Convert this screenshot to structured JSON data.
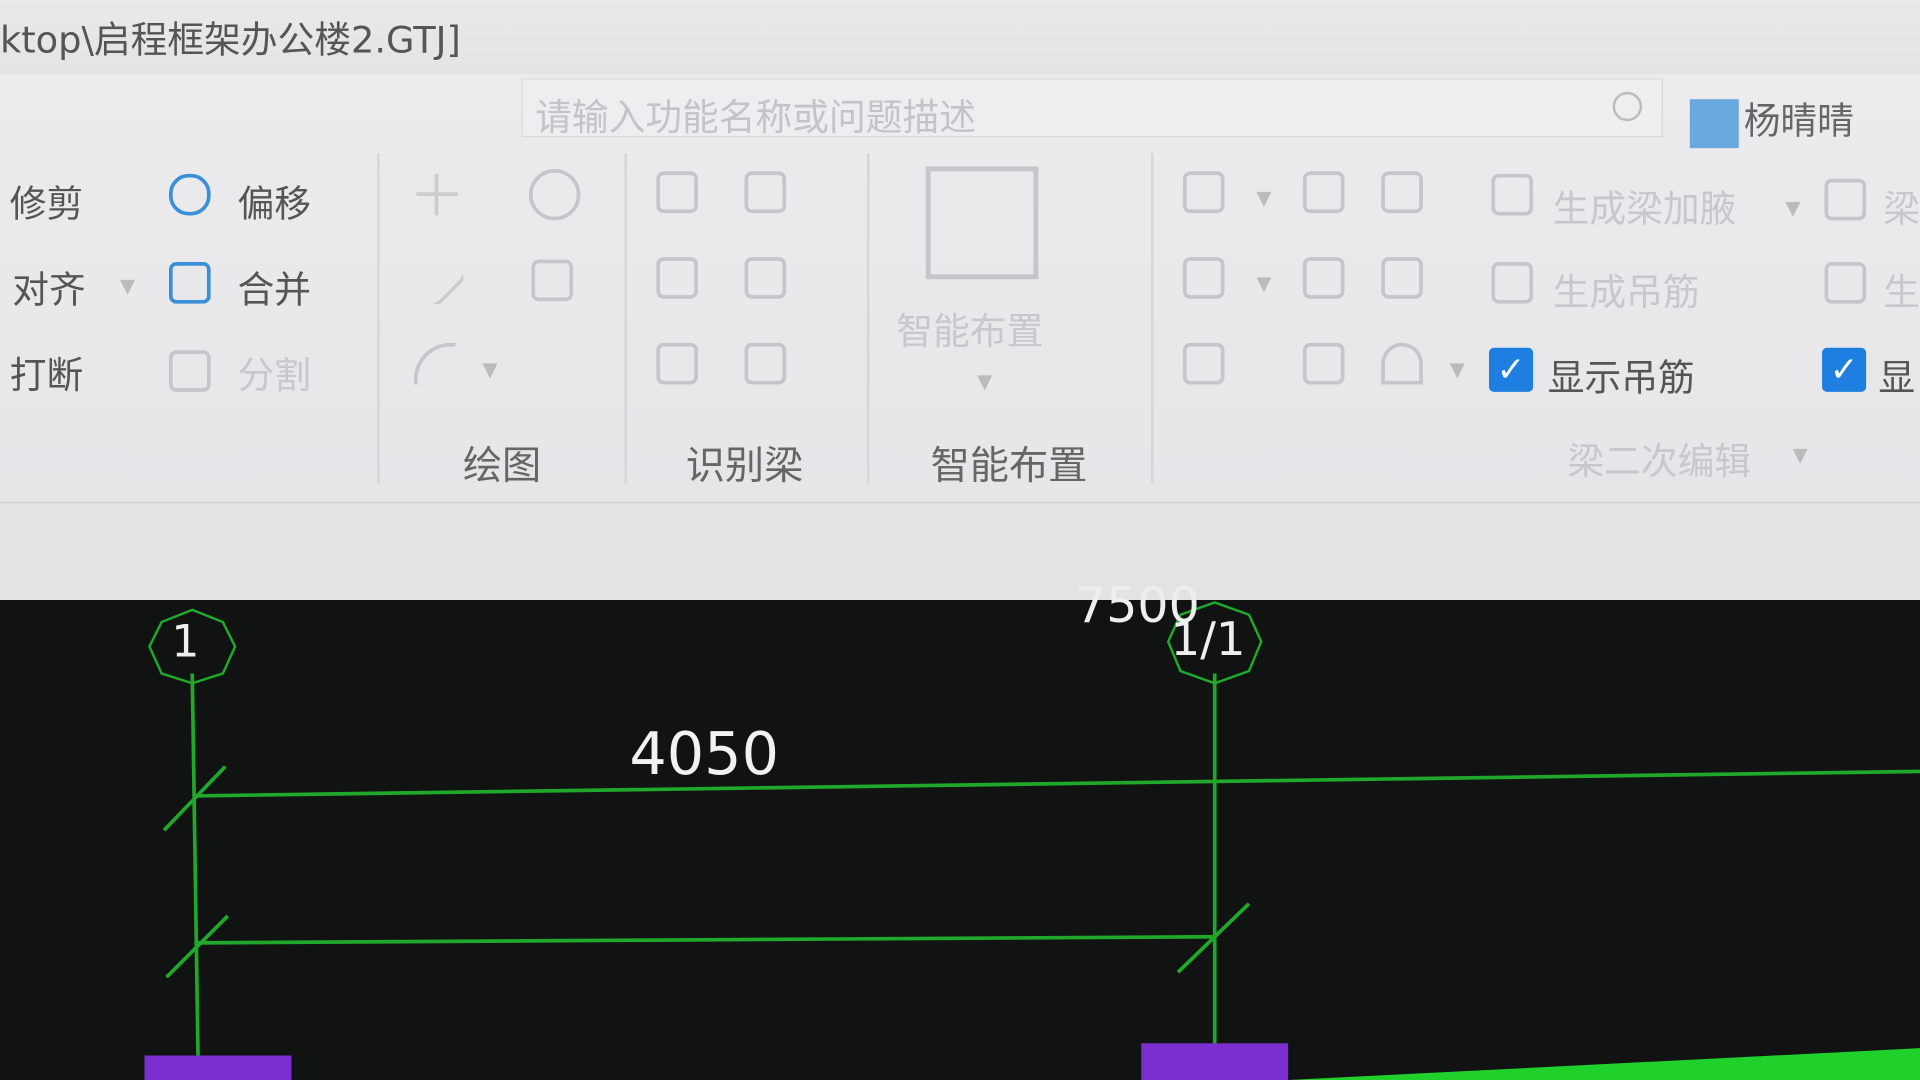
{
  "window": {
    "title": "ktop\\启程框架办公楼2.GTJ]"
  },
  "search": {
    "placeholder": "请输入功能名称或问题描述"
  },
  "user": {
    "name": "杨晴晴"
  },
  "ribbon": {
    "modify": {
      "trim": "修剪",
      "offset": "偏移",
      "align": "对齐",
      "merge": "合并",
      "break": "打断",
      "split": "分割"
    },
    "groups": {
      "draw": "绘图",
      "identify_beam": "识别梁",
      "smart_layout": "智能布置"
    },
    "smart_layout_button": "智能布置",
    "beam_edit": {
      "gen_haunch": "生成梁加腋",
      "gen_hanger": "生成吊筋",
      "show_hanger": "显示吊筋",
      "show_hanger_checked": true,
      "group_label": "梁二次编辑",
      "partial_1": "梁",
      "partial_2": "生",
      "partial_3": "显",
      "partial_3_checked": true
    }
  },
  "canvas": {
    "axis_1": "1",
    "axis_1_1": "1/1",
    "dim_top": "7500",
    "dim_span": "4050",
    "colors": {
      "grid": "#1fa82a",
      "column": "#7b2fd0",
      "background": "#101312"
    }
  }
}
